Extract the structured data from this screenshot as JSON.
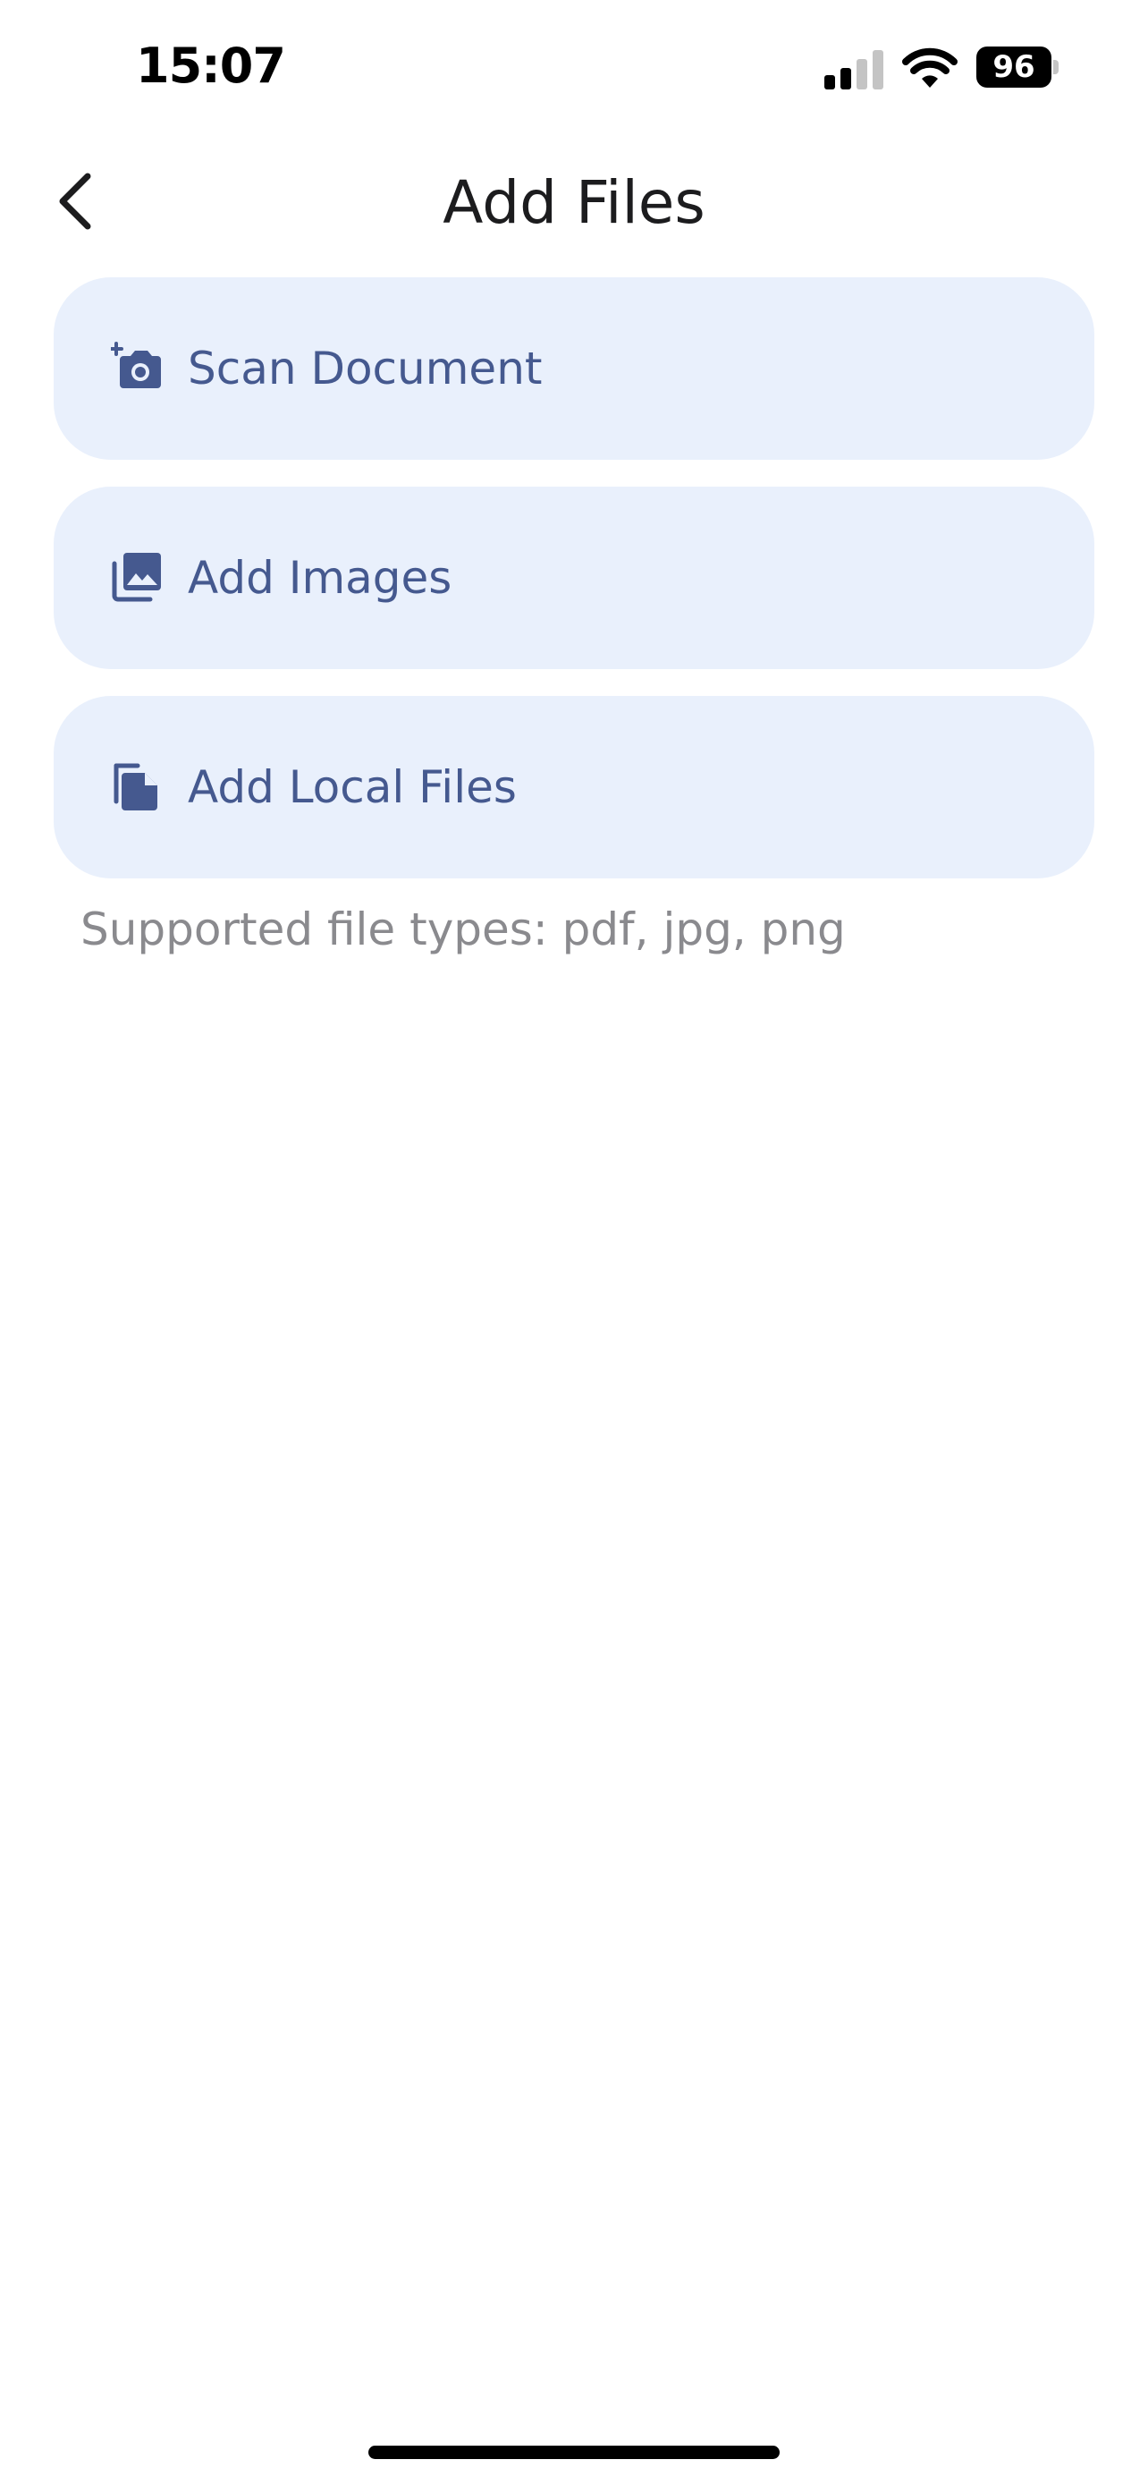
{
  "status_bar": {
    "time": "15:07",
    "battery": "96",
    "icons": [
      "signal-icon",
      "wifi-icon",
      "battery-icon"
    ]
  },
  "header": {
    "back_icon": "chevron-left-icon",
    "title": "Add Files"
  },
  "options": [
    {
      "label": "Scan Document",
      "icon": "add-camera-icon"
    },
    {
      "label": "Add Images",
      "icon": "photo-library-icon"
    },
    {
      "label": "Add Local Files",
      "icon": "file-copy-icon"
    }
  ],
  "supported_types": "Supported file types: pdf, jpg, png",
  "colors": {
    "card_background": "#e9f0fc",
    "accent": "#45598f",
    "title": "#1c1c1e",
    "muted_text": "#8a8a8e"
  }
}
